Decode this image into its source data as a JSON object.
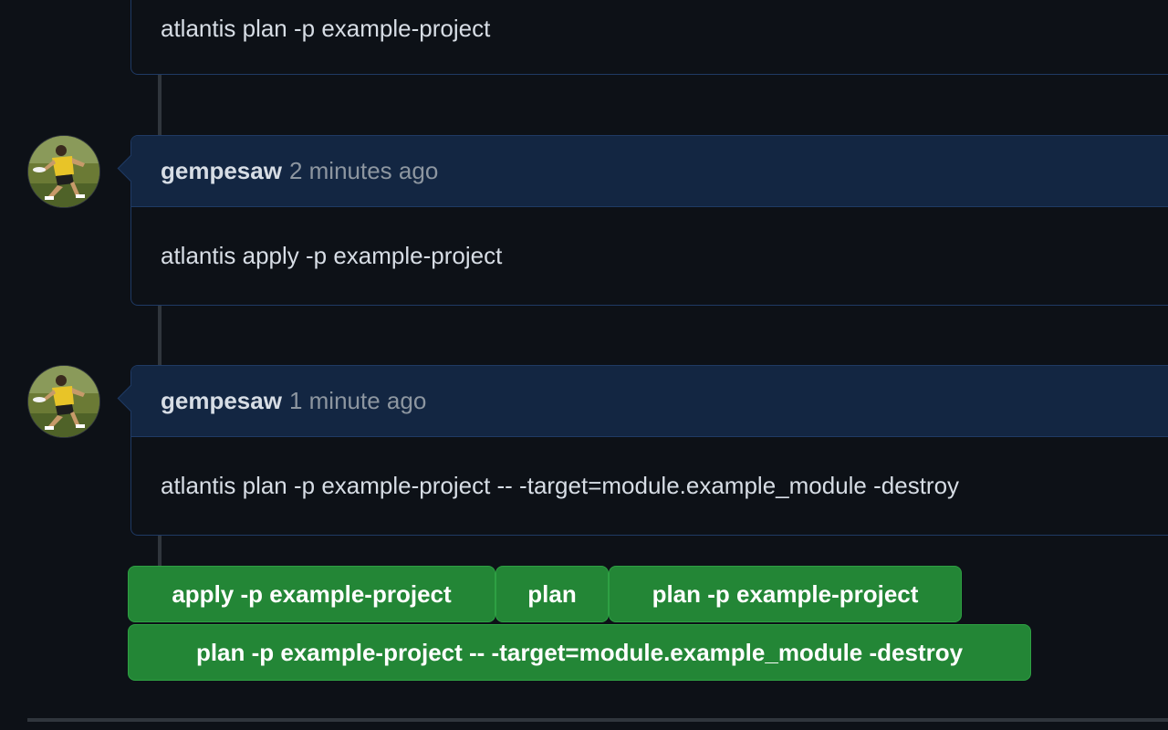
{
  "comments": [
    {
      "body": "atlantis plan -p example-project"
    },
    {
      "author": "gempesaw",
      "time": "2 minutes ago",
      "body": "atlantis apply -p example-project"
    },
    {
      "author": "gempesaw",
      "time": "1 minute ago",
      "body": "atlantis plan -p example-project -- -target=module.example_module -destroy"
    }
  ],
  "suggestions": [
    "apply -p example-project",
    "plan",
    "plan -p example-project",
    "plan -p example-project -- -target=module.example_module -destroy"
  ],
  "colors": {
    "background": "#0d1117",
    "header_bg": "#132642",
    "border": "#1f3a64",
    "button_bg": "#238636"
  }
}
